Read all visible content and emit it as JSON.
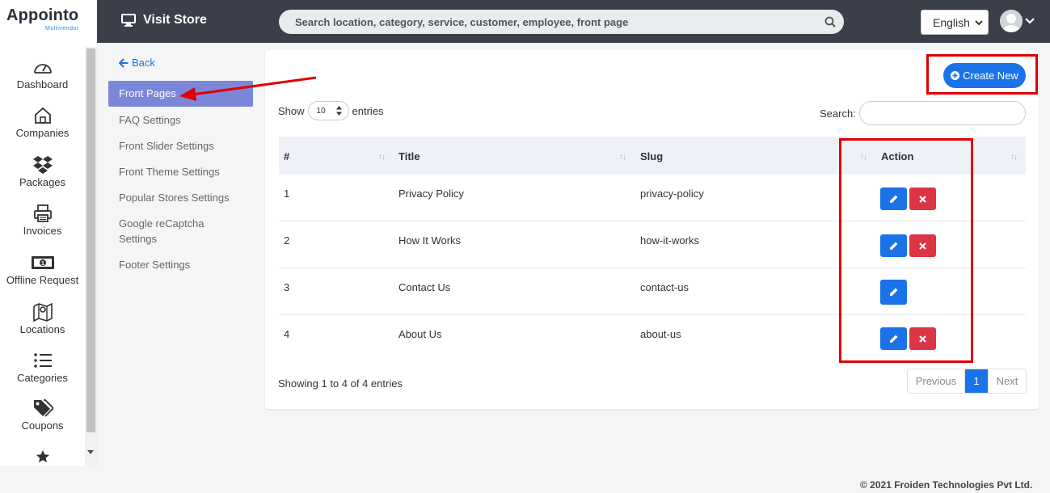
{
  "brand": {
    "name": "Appointo",
    "tagline": "Multivendor"
  },
  "topbar": {
    "visit_store": "Visit Store",
    "search_placeholder": "Search location, category, service, customer, employee, front page",
    "language": "English"
  },
  "sidebar": {
    "items": [
      {
        "label": "Dashboard",
        "icon": "dashboard-gauge-icon"
      },
      {
        "label": "Companies",
        "icon": "home-icon"
      },
      {
        "label": "Packages",
        "icon": "dropbox-icon"
      },
      {
        "label": "Invoices",
        "icon": "printer-icon"
      },
      {
        "label": "Offline Request",
        "icon": "money-bill-icon"
      },
      {
        "label": "Locations",
        "icon": "map-icon"
      },
      {
        "label": "Categories",
        "icon": "list-icon"
      },
      {
        "label": "Coupons",
        "icon": "tags-icon"
      },
      {
        "label": "",
        "icon": "star-icon"
      }
    ]
  },
  "settings_menu": {
    "back": "Back",
    "items": [
      "Front Pages",
      "FAQ Settings",
      "Front Slider Settings",
      "Front Theme Settings",
      "Popular Stores Settings",
      "Google reCaptcha Settings",
      "Footer Settings"
    ],
    "active": "Front Pages"
  },
  "card": {
    "create_button": "Create New",
    "show": "Show",
    "entries_value": "10",
    "entries": "entries",
    "search_label": "Search:",
    "columns": [
      "#",
      "Title",
      "Slug",
      "Action"
    ],
    "rows": [
      {
        "num": "1",
        "title": "Privacy Policy",
        "slug": "privacy-policy",
        "actions": [
          "edit",
          "delete"
        ]
      },
      {
        "num": "2",
        "title": "How It Works",
        "slug": "how-it-works",
        "actions": [
          "edit",
          "delete"
        ]
      },
      {
        "num": "3",
        "title": "Contact Us",
        "slug": "contact-us",
        "actions": [
          "edit"
        ]
      },
      {
        "num": "4",
        "title": "About Us",
        "slug": "about-us",
        "actions": [
          "edit",
          "delete"
        ]
      }
    ],
    "info": "Showing 1 to 4 of 4 entries",
    "pagination": {
      "previous": "Previous",
      "current": "1",
      "next": "Next"
    }
  },
  "footer": "© 2021 Froiden Technologies Pvt Ltd.",
  "colors": {
    "primary": "#1a73e8",
    "danger": "#dc3545",
    "highlight": "#e00000",
    "active_menu": "#7c86d9",
    "topbar": "#3a3f4a"
  }
}
